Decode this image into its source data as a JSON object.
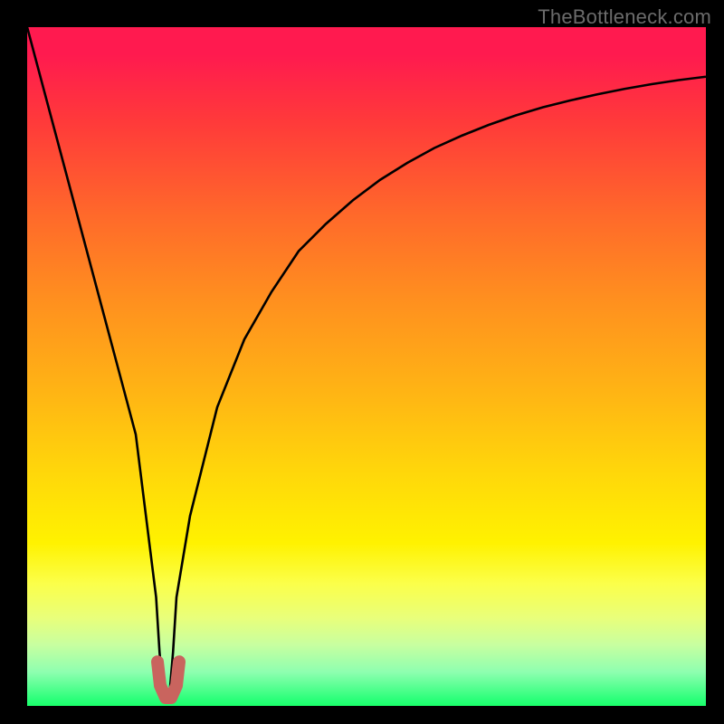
{
  "watermark": "TheBottleneck.com",
  "colors": {
    "frame": "#000000",
    "curve": "#000000",
    "marker_fill": "#c9645e",
    "marker_stroke": "#c9645e",
    "gradient_top": "#ff1a4f",
    "gradient_bottom": "#1aff6a"
  },
  "chart_data": {
    "type": "line",
    "title": "",
    "xlabel": "",
    "ylabel": "",
    "xlim": [
      0,
      100
    ],
    "ylim": [
      0,
      100
    ],
    "grid": false,
    "legend": false,
    "annotations": [],
    "series": [
      {
        "name": "bottleneck-curve",
        "x": [
          0,
          4,
          8,
          12,
          16,
          19,
          19.5,
          20,
          20.5,
          21,
          21.5,
          22,
          24,
          28,
          32,
          36,
          40,
          44,
          48,
          52,
          56,
          60,
          64,
          68,
          72,
          76,
          80,
          84,
          88,
          92,
          96,
          100
        ],
        "values": [
          100,
          85,
          70,
          55,
          40,
          16,
          8,
          2,
          1,
          2,
          8,
          16,
          28,
          44,
          54,
          61,
          67,
          71,
          74.5,
          77.5,
          80,
          82.2,
          84,
          85.6,
          87,
          88.2,
          89.2,
          90.1,
          90.9,
          91.6,
          92.2,
          92.7
        ]
      }
    ],
    "marker": {
      "name": "u-bottom",
      "points": [
        {
          "x": 19.2,
          "y": 6.5
        },
        {
          "x": 19.6,
          "y": 3.0
        },
        {
          "x": 20.4,
          "y": 1.2
        },
        {
          "x": 21.2,
          "y": 1.2
        },
        {
          "x": 22.0,
          "y": 3.0
        },
        {
          "x": 22.4,
          "y": 6.5
        }
      ]
    }
  }
}
